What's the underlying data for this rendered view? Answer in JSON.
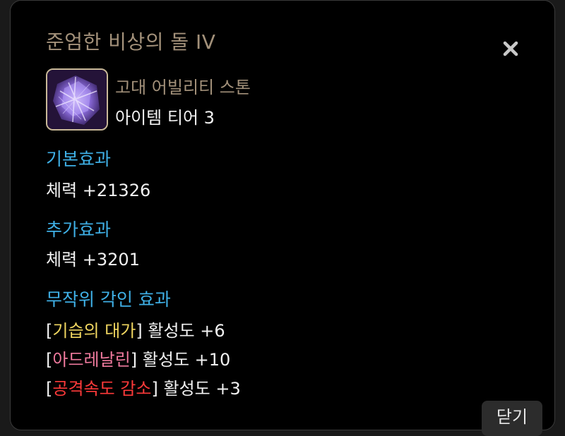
{
  "item": {
    "name": "준엄한 비상의 돌 IV",
    "type": "고대 어빌리티 스톤",
    "tier": "아이템 티어 3",
    "icon": "ability-stone-icon"
  },
  "base_effect": {
    "title": "기본효과",
    "value": "체력 +21326"
  },
  "extra_effect": {
    "title": "추가효과",
    "value": "체력 +3201"
  },
  "random_engraving": {
    "title": "무작위 각인 효과",
    "items": [
      {
        "name": "기습의 대가",
        "value": "활성도 +6",
        "color": "#f0d660"
      },
      {
        "name": "아드레날린",
        "value": "활성도 +10",
        "color": "#f07a9e"
      },
      {
        "name": "공격속도 감소",
        "value": "활성도 +3",
        "color": "#ff3a3a"
      }
    ]
  },
  "buttons": {
    "close_label": "닫기"
  },
  "colors": {
    "title": "#a3917a",
    "section": "#3fb0e6",
    "text": "#f2f2f2",
    "background": "#000000"
  }
}
